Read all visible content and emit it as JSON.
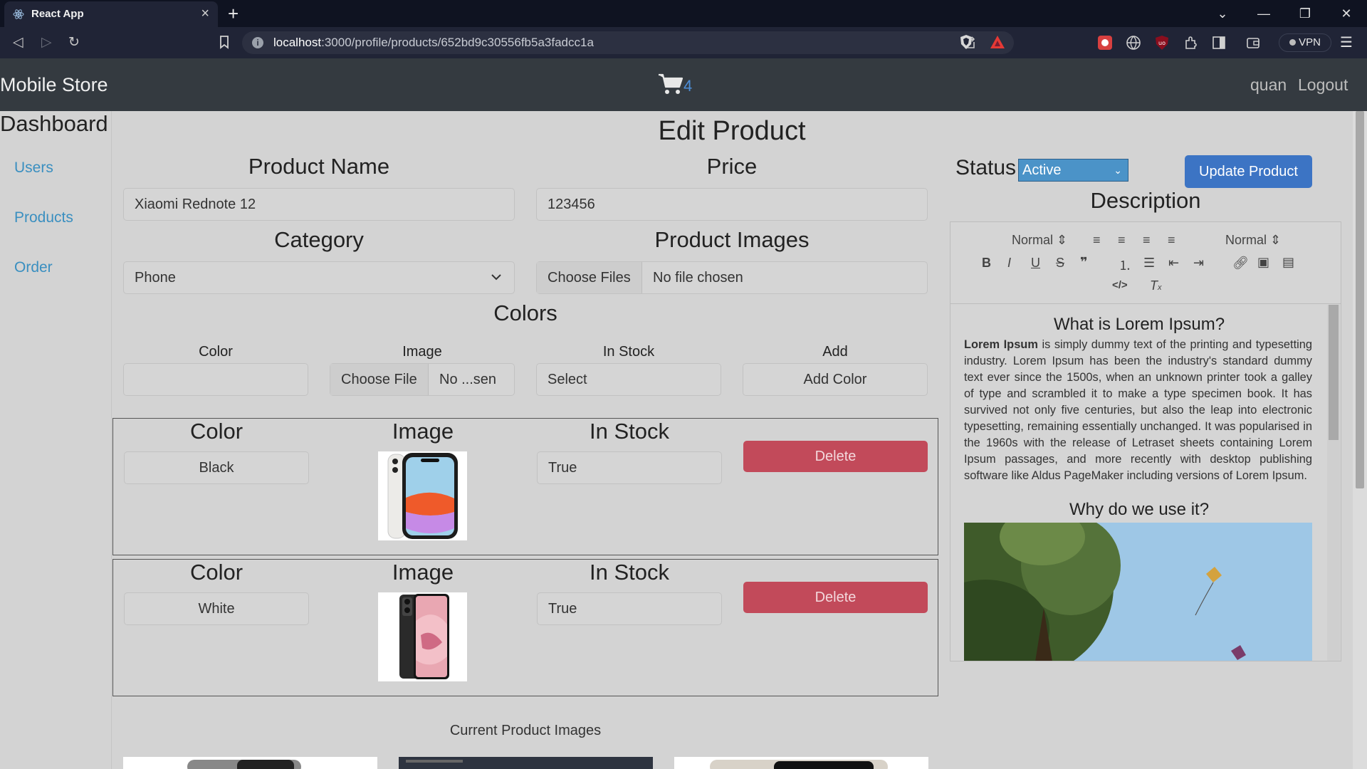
{
  "browser": {
    "tab_title": "React App",
    "url_host": "localhost",
    "url_rest": ":3000/profile/products/652bd9c30556fb5a3fadcc1a",
    "vpn_label": "VPN"
  },
  "navbar": {
    "brand": "Mobile Store",
    "cart_count": "4",
    "user": "quan",
    "logout": "Logout"
  },
  "sidebar": {
    "title": "Dashboard",
    "items": [
      {
        "label": "Users"
      },
      {
        "label": "Products"
      },
      {
        "label": "Order"
      }
    ]
  },
  "form": {
    "page_title": "Edit Product",
    "product_name_label": "Product Name",
    "product_name_value": "Xiaomi Rednote 12",
    "price_label": "Price",
    "price_value": "123456",
    "category_label": "Category",
    "category_value": "Phone",
    "images_label": "Product Images",
    "choose_files": "Choose Files",
    "no_file": "No file chosen",
    "status_label": "Status",
    "status_value": "Active",
    "update_button": "Update Product",
    "description_label": "Description"
  },
  "colors": {
    "title": "Colors",
    "col_color": "Color",
    "col_image": "Image",
    "col_stock": "In Stock",
    "col_add": "Add",
    "choose_file": "Choose File",
    "no_file_short": "No ...sen",
    "stock_placeholder": "Select",
    "add_button": "Add Color",
    "entries": [
      {
        "color": "Black",
        "stock": "True",
        "delete": "Delete"
      },
      {
        "color": "White",
        "stock": "True",
        "delete": "Delete"
      }
    ]
  },
  "editor": {
    "header_size": "Normal",
    "font_size": "Normal",
    "heading1": "What is Lorem Ipsum?",
    "bold_lead": "Lorem Ipsum",
    "paragraph": " is simply dummy text of the printing and typesetting industry. Lorem Ipsum has been the industry's standard dummy text ever since the 1500s, when an unknown printer took a galley of type and scrambled it to make a type specimen book. It has survived not only five centuries, but also the leap into electronic typesetting, remaining essentially unchanged. It was popularised in the 1960s with the release of Letraset sheets containing Lorem Ipsum passages, and more recently with desktop publishing software like Aldus PageMaker including versions of Lorem Ipsum.",
    "heading2": "Why do we use it?"
  },
  "current_images_title": "Current Product Images"
}
